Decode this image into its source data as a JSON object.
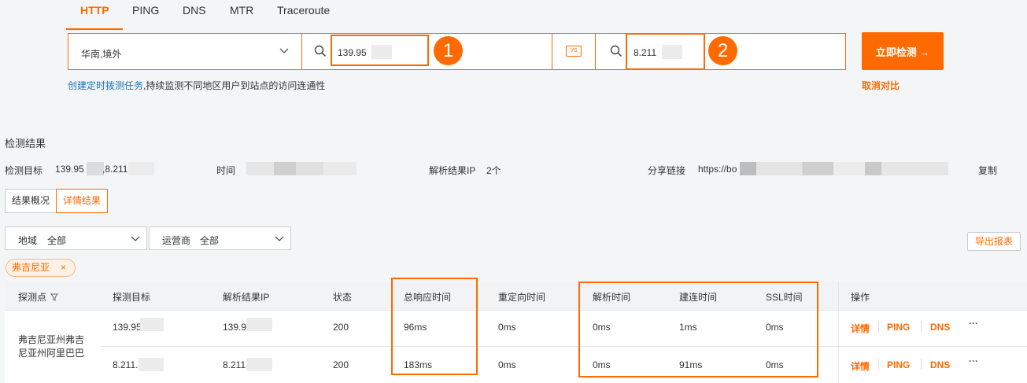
{
  "tabs": [
    {
      "label": "HTTP",
      "active": true
    },
    {
      "label": "PING"
    },
    {
      "label": "DNS"
    },
    {
      "label": "MTR"
    },
    {
      "label": "Traceroute"
    }
  ],
  "search": {
    "region": "华南,境外",
    "target1": "139.95",
    "vs_label": "VS",
    "target2": "8.211",
    "marker1": "1",
    "marker2": "2",
    "submit_label": "立即检测 →",
    "cancel_compare": "取消对比"
  },
  "hint": {
    "link": "创建定时拨测任务",
    "text": ",持续监测不同地区用户到站点的访问连通性"
  },
  "results": {
    "title": "检测结果",
    "target_label": "检测目标",
    "target_value_1": "139.95",
    "target_value_2": ",8.211",
    "time_label": "时间",
    "resolve_label": "解析结果IP",
    "resolve_count": "2个",
    "share_label": "分享链接",
    "share_value": "https://bo",
    "copy_label": "复制"
  },
  "view_toggle": {
    "overview": "结果概况",
    "detail": "详情结果"
  },
  "filters": {
    "region_label": "地域",
    "region_value": "全部",
    "isp_label": "运营商",
    "isp_value": "全部",
    "export_label": "导出报表"
  },
  "chip": {
    "label": "弗吉尼亚",
    "close": "×"
  },
  "table": {
    "headers": {
      "probe": "探测点",
      "target": "探测目标",
      "ip": "解析结果IP",
      "status": "状态",
      "total": "总响应时间",
      "redirect": "重定向时间",
      "dns": "解析时间",
      "connect": "建连时间",
      "ssl": "SSL时间",
      "ops": "操作"
    },
    "probe_name": "弗吉尼亚州弗吉尼亚州阿里巴巴",
    "probe_line1": "弗吉尼亚州弗吉",
    "probe_line2": "尼亚州阿里巴巴",
    "rows": [
      {
        "target": "139.95",
        "ip": "139.9",
        "status": "200",
        "total": "96ms",
        "redirect": "0ms",
        "dns": "0ms",
        "connect": "1ms",
        "ssl": "0ms"
      },
      {
        "target": "8.211.",
        "ip": "8.211",
        "status": "200",
        "total": "183ms",
        "redirect": "0ms",
        "dns": "0ms",
        "connect": "91ms",
        "ssl": "0ms"
      }
    ],
    "ops": {
      "detail": "详情",
      "ping": "PING",
      "dns": "DNS",
      "more": "···"
    }
  },
  "colors": {
    "accent": "#ff6a00",
    "link_blue": "#1a73b8"
  }
}
